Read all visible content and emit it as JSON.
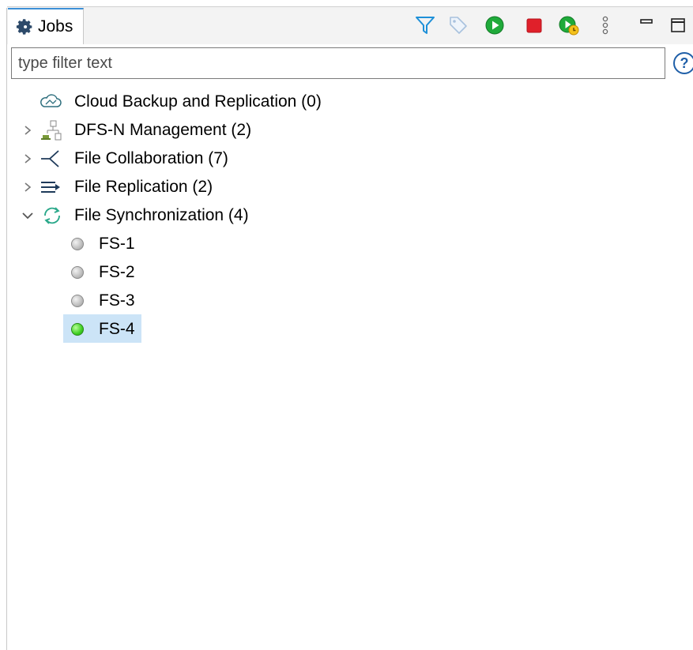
{
  "view": {
    "tab_label": "Jobs",
    "tab_icon": "gear-icon"
  },
  "toolbar": {
    "icons": [
      "filter-icon",
      "tag-icon",
      "start-icon",
      "stop-icon",
      "run-now-icon",
      "view-menu-icon",
      "minimize-icon",
      "maximize-icon"
    ],
    "accent_blue": "#1e90d8",
    "start_green": "#1faa3a",
    "stop_red": "#e0202a"
  },
  "filter": {
    "placeholder": "type filter text",
    "value": "",
    "help_label": "?"
  },
  "tree": {
    "items": [
      {
        "label": "Cloud Backup and Replication (0)",
        "icon": "cloud-icon",
        "expandable": false
      },
      {
        "label": "DFS-N Management (2)",
        "icon": "dfs-namespace-icon",
        "expandable": true,
        "expanded": false
      },
      {
        "label": "File Collaboration (7)",
        "icon": "collaboration-icon",
        "expandable": true,
        "expanded": false
      },
      {
        "label": "File Replication (2)",
        "icon": "replication-arrows-icon",
        "expandable": true,
        "expanded": false
      },
      {
        "label": "File Synchronization (4)",
        "icon": "sync-icon",
        "expandable": true,
        "expanded": true,
        "children": [
          {
            "label": "FS-1",
            "status": "idle"
          },
          {
            "label": "FS-2",
            "status": "idle"
          },
          {
            "label": "FS-3",
            "status": "idle"
          },
          {
            "label": "FS-4",
            "status": "running",
            "selected": true
          }
        ]
      }
    ]
  }
}
